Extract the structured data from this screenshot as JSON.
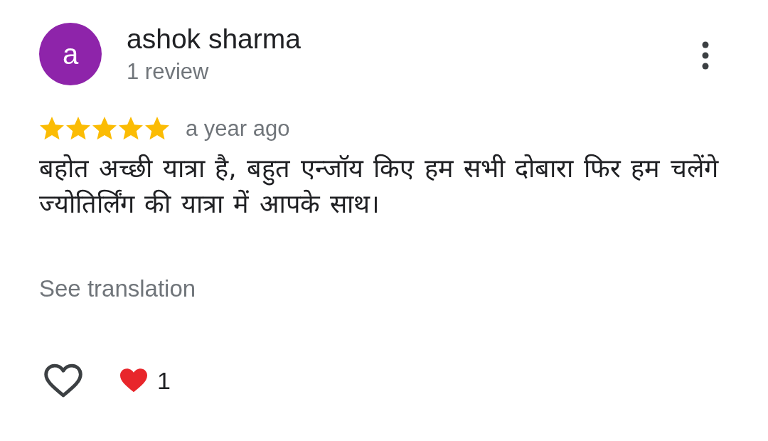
{
  "review": {
    "author": {
      "initial": "a",
      "name": "ashok sharma",
      "review_count": "1 review"
    },
    "stars": 5,
    "time": "a year ago",
    "text": "बहोत अच्छी यात्रा है, बहुत एन्जॉय किए हम सभी दोबारा फिर हम चलेंगे ज्योतिर्लिंग की यात्रा में आपके साथ।",
    "translate_link": "See translation",
    "liked": false,
    "reactions": [
      {
        "kind": "heart",
        "count": "1"
      }
    ]
  }
}
